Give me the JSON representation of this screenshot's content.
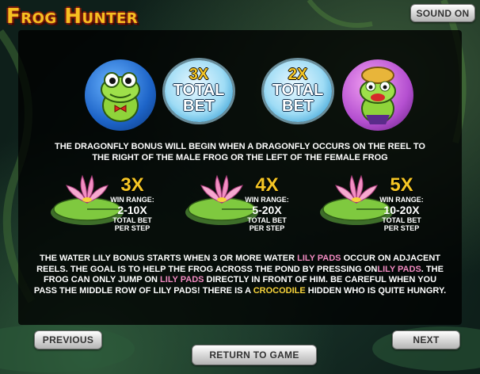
{
  "app": {
    "logo": "Frog Hunter"
  },
  "buttons": {
    "sound": "SOUND ON",
    "previous": "PREVIOUS",
    "next": "NEXT",
    "return": "RETURN TO GAME"
  },
  "dragonfly": {
    "left_multiplier": "3X",
    "left_label": "TOTAL BET",
    "right_multiplier": "2X",
    "right_label": "TOTAL BET",
    "description": "THE DRAGONFLY BONUS WILL BEGIN WHEN A DRAGONFLY OCCURS ON THE REEL TO THE RIGHT OF THE MALE FROG OR THE LEFT OF THE FEMALE FROG"
  },
  "lily": [
    {
      "multiplier": "3X",
      "win_label": "WIN RANGE:",
      "range": "2-10X",
      "total": "TOTAL BET PER STEP"
    },
    {
      "multiplier": "4X",
      "win_label": "WIN RANGE:",
      "range": "5-20X",
      "total": "TOTAL BET PER STEP"
    },
    {
      "multiplier": "5X",
      "win_label": "WIN RANGE:",
      "range": "10-20X",
      "total": "TOTAL BET PER STEP"
    }
  ],
  "lily_text": {
    "p1": "THE WATER LILY BONUS STARTS WHEN 3 OR MORE WATER ",
    "h1": "LILY PADS",
    "p2": " OCCUR ON ADJACENT REELS. THE GOAL IS TO HELP THE FROG ACROSS THE POND BY PRESSING ON",
    "h2": "LILY PADS",
    "p3": ". THE FROG CAN ONLY JUMP ON ",
    "h3": "LILY PADS",
    "p4": " DIRECTLY IN FRONT OF HIM. BE CAREFUL WHEN YOU PASS THE MIDDLE ROW OF LILY PADS! THERE IS A ",
    "h4": "CROCODILE",
    "p5": " HIDDEN WHO IS QUITE HUNGRY."
  },
  "colors": {
    "accent_yellow": "#f5c625",
    "pink": "#f08ac0",
    "panel": "#000000"
  },
  "icons": [
    "male-frog-icon",
    "female-frog-icon",
    "water-lily-icon",
    "splash-icon"
  ]
}
